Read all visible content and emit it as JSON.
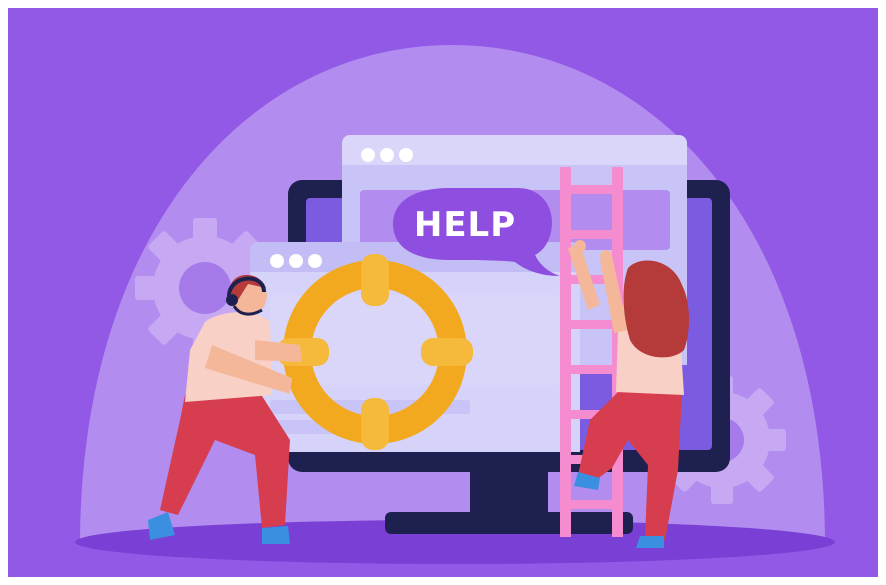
{
  "illustration": {
    "speech_bubble": {
      "text": "HELP"
    },
    "colors": {
      "background": "#9159e6",
      "dome": "#b28cee",
      "dome_inner": "#a67be9",
      "floor_shadow": "#7a3fd4",
      "gear": "#c7a9f3",
      "monitor_frame": "#1e2150",
      "monitor_screen": "#7b5ce0",
      "window_back": "#c9c4f7",
      "window_back_header": "#d9d6fa",
      "window_front": "#d5d3f9",
      "window_front_header": "#c3bdf5",
      "window_dots": "#ffffff",
      "bubble": "#8e4fe0",
      "bubble_text": "#ffffff",
      "lifebuoy": "#f2a91f",
      "lifebuoy_band": "#f5b93c",
      "ladder": "#f48ccf",
      "pants": "#d63d4f",
      "shirt": "#f8d0c5",
      "skin": "#f4b79a",
      "hair": "#b53a3a",
      "shoes": "#3b8fe0"
    }
  }
}
